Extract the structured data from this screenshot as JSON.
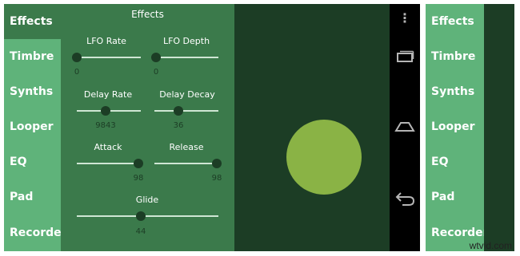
{
  "tabs": [
    {
      "label": "Effects",
      "active": true
    },
    {
      "label": "Timbre",
      "active": false
    },
    {
      "label": "Synths",
      "active": false
    },
    {
      "label": "Looper",
      "active": false
    },
    {
      "label": "EQ",
      "active": false
    },
    {
      "label": "Pad",
      "active": false
    },
    {
      "label": "Recorder",
      "active": false
    }
  ],
  "panel": {
    "title": "Effects",
    "controls": {
      "lfo_rate": {
        "label": "LFO Rate",
        "value": "0"
      },
      "lfo_depth": {
        "label": "LFO Depth",
        "value": "0"
      },
      "delay_rate": {
        "label": "Delay Rate",
        "value": "9843"
      },
      "delay_decay": {
        "label": "Delay Decay",
        "value": "36"
      },
      "attack": {
        "label": "Attack",
        "value": "98"
      },
      "release": {
        "label": "Release",
        "value": "98"
      },
      "glide": {
        "label": "Glide",
        "value": "44"
      }
    }
  },
  "right_tabs": [
    {
      "label": "Effects",
      "active": false
    },
    {
      "label": "Timbre",
      "active": false
    },
    {
      "label": "Synths",
      "active": false
    },
    {
      "label": "Looper",
      "active": false
    },
    {
      "label": "EQ",
      "active": false
    },
    {
      "label": "Pad",
      "active": false
    },
    {
      "label": "Recorder",
      "active": false
    }
  ],
  "nav_icons": [
    "menu-dots-icon",
    "recent-apps-icon",
    "home-icon",
    "back-icon"
  ],
  "watermark": "wtvid.com",
  "colors": {
    "panel": "#3b7a4b",
    "tab_inactive": "#5fb37a",
    "xy_pad": "#1c3d25",
    "pad_circle": "#8ab345"
  }
}
